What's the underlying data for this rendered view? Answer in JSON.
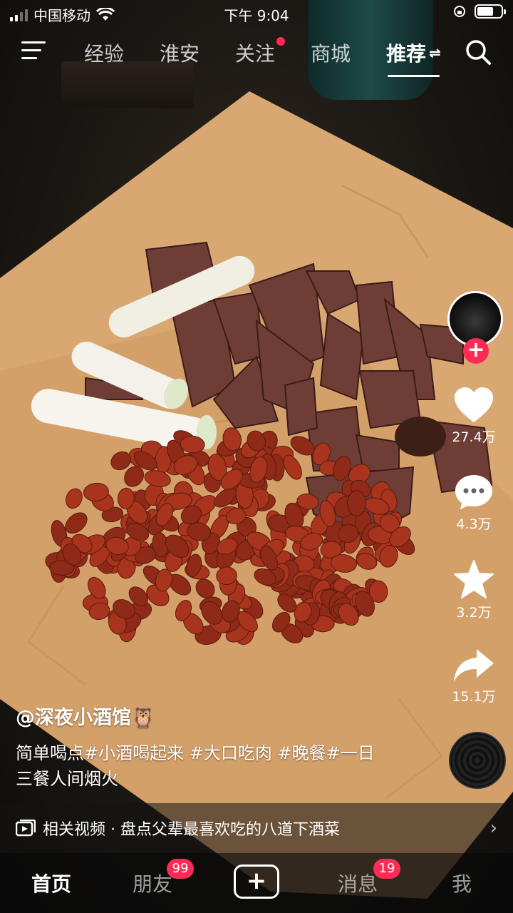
{
  "status_bar": {
    "carrier": "中国移动",
    "time": "下午 9:04"
  },
  "top_nav": {
    "tabs": [
      {
        "label": "经验",
        "active": false
      },
      {
        "label": "淮安",
        "active": false
      },
      {
        "label": "关注",
        "active": false,
        "dot": true
      },
      {
        "label": "商城",
        "active": false
      },
      {
        "label": "推荐",
        "active": true
      }
    ]
  },
  "rail": {
    "likes": "27.4万",
    "comments": "4.3万",
    "favorites": "3.2万",
    "shares": "15.1万"
  },
  "video": {
    "author": "@深夜小酒馆🦉",
    "caption": "简单喝点#小酒喝起来 #大口吃肉 #晚餐#一日三餐人间烟火",
    "related": "相关视频 · 盘点父辈最喜欢吃的八道下酒菜"
  },
  "tabbar": {
    "home": "首页",
    "friends": "朋友",
    "friends_badge": "99",
    "add": "+",
    "messages": "消息",
    "messages_badge": "19",
    "me": "我"
  },
  "colors": {
    "accent": "#fe2c55",
    "paper": "#d9a66c",
    "peanut": "#a8341d"
  }
}
